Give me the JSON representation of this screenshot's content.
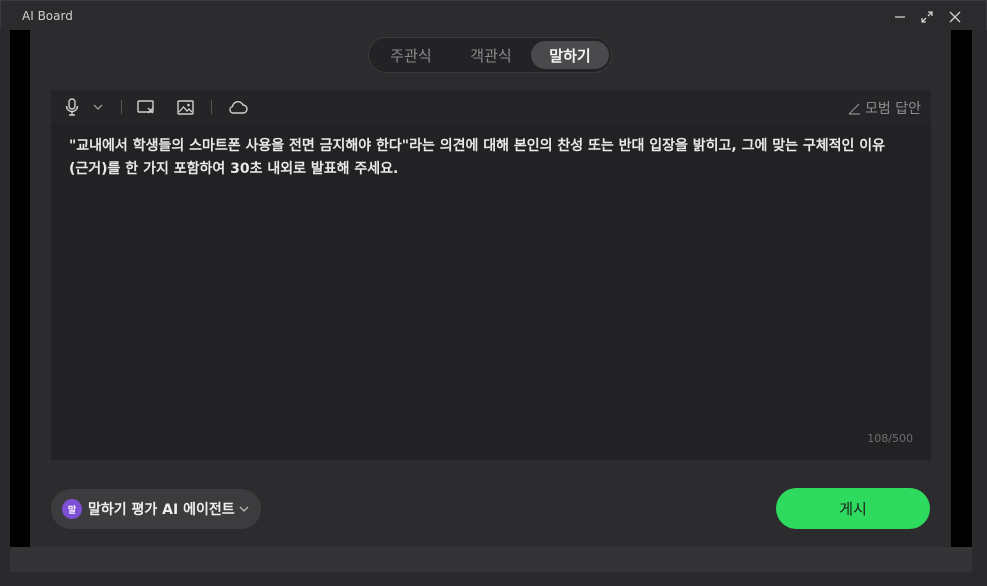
{
  "window": {
    "title": "AI Board"
  },
  "tabs": [
    {
      "label": "주관식",
      "selected": false
    },
    {
      "label": "객관식",
      "selected": false
    },
    {
      "label": "말하기",
      "selected": true
    }
  ],
  "toolbar": {
    "icons": [
      "microphone-icon",
      "chevron-down-icon",
      "screen-capture-icon",
      "image-icon",
      "cloud-icon"
    ],
    "model_answer_label": "모범 답안"
  },
  "editor": {
    "line1": "\"교내에서 학생들의 스마트폰 사용을 전면 금지해야 한다\"라는 의견에 대해 본인의 찬성 또는 반대 입장을 밝히고, 그에 맞는 구체적인 이유",
    "line2": "(근거)를 한 가지 포함하여 30초 내외로 발표해 주세요.",
    "char_count": "108/500"
  },
  "agent": {
    "avatar_text": "말",
    "label": "말하기 평가 AI 에이전트"
  },
  "actions": {
    "post_label": "게시"
  },
  "colors": {
    "accent": "#2fdb5f",
    "agent_avatar": "#7d4fd6",
    "background": "#2c2c2e"
  }
}
